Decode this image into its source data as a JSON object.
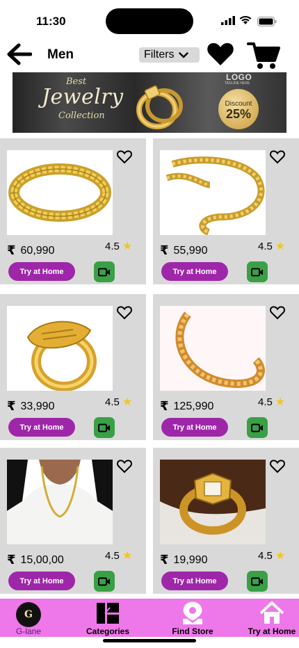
{
  "status_bar": {
    "time": "11:30"
  },
  "header": {
    "title": "Men",
    "filters_label": "Filters"
  },
  "banner": {
    "best": "Best",
    "jewelry": "Jewelry",
    "collection": "Collection",
    "logo": "LOGO",
    "tagline": "TAGLINE HERE",
    "discount_label": "Discount",
    "discount_value": "25%"
  },
  "currency_symbol": "₹",
  "star_glyph": "★",
  "products": [
    {
      "price": "60,990",
      "rating": "4.5",
      "try_label": "Try at Home",
      "image": "gold-link-bracelet"
    },
    {
      "price": "55,990",
      "rating": "4.5",
      "try_label": "Try at Home",
      "image": "gold-rope-chain"
    },
    {
      "price": "33,990",
      "rating": "4.5",
      "try_label": "Try at Home",
      "image": "gold-hand-ring"
    },
    {
      "price": "125,990",
      "rating": "4.5",
      "try_label": "Try at Home",
      "image": "gold-twisted-bracelet"
    },
    {
      "price": "15,00,00",
      "rating": "4.5",
      "try_label": "Try at Home",
      "image": "man-wearing-gold-chain"
    },
    {
      "price": "19,990",
      "rating": "4.5",
      "try_label": "Try at Home",
      "image": "gold-signet-ring"
    }
  ],
  "bottom_nav": [
    {
      "label": "G-lane",
      "icon": "glane-logo",
      "logo_text": "G"
    },
    {
      "label": "Categories",
      "icon": "categories-icon"
    },
    {
      "label": "Find Store",
      "icon": "location-pin-icon"
    },
    {
      "label": "Try at Home",
      "icon": "home-icon"
    }
  ],
  "colors": {
    "try_button": "#9e27a9",
    "video_button": "#39a046",
    "bottom_nav": "#ee77e9",
    "card_bg": "#d9d9d9"
  }
}
